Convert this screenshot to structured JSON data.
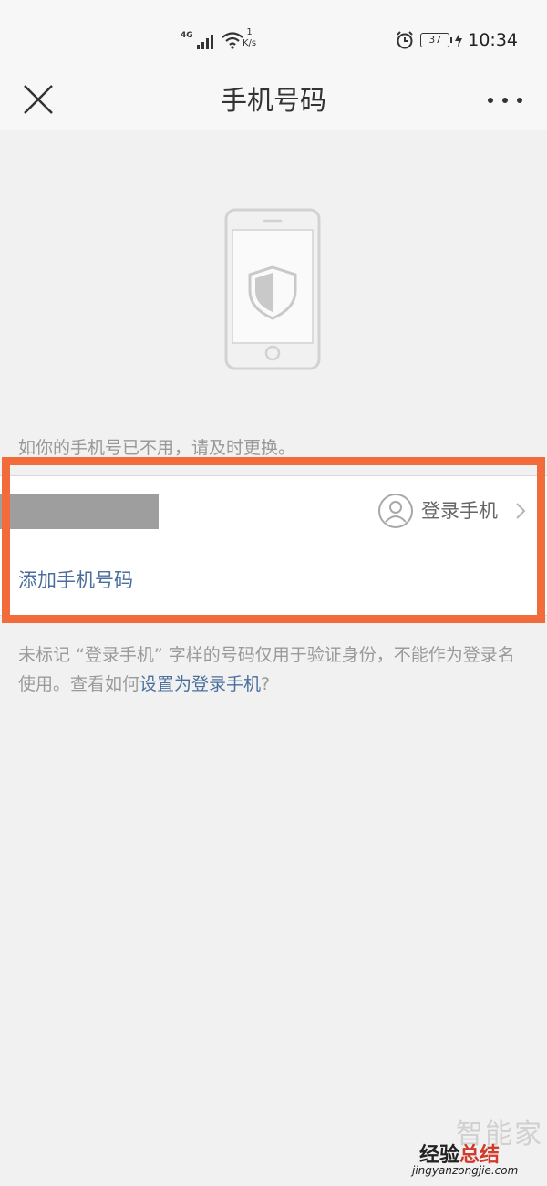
{
  "status_bar": {
    "network": "4G",
    "speed_value": "1",
    "speed_unit": "K/s",
    "battery": "37",
    "time": "10:34",
    "icons": [
      "signal-icon",
      "wifi-icon",
      "alarm-icon",
      "battery-icon",
      "charging-icon"
    ]
  },
  "header": {
    "title": "手机号码",
    "close_icon": "close-icon",
    "more_icon": "more-icon"
  },
  "hero": {
    "icon": "phone-shield-icon"
  },
  "hint": "如你的手机号已不用，请及时更换。",
  "phone_list": {
    "tag_label": "登录手机",
    "add_label": "添加手机号码"
  },
  "note": {
    "text": "未标记 “登录手机” 字样的号码仅用于验证身份，不能作为登录名使用。查看如何",
    "link": "设置为登录手机",
    "suffix": "?"
  },
  "colors": {
    "accent": "#4a6f9c",
    "highlight": "#f26b3a",
    "background": "#f1f1f1"
  },
  "watermark": {
    "logo": "智能家",
    "brand_a": "经验",
    "brand_b": "总结",
    "url": "jingyanzongjie.com"
  }
}
